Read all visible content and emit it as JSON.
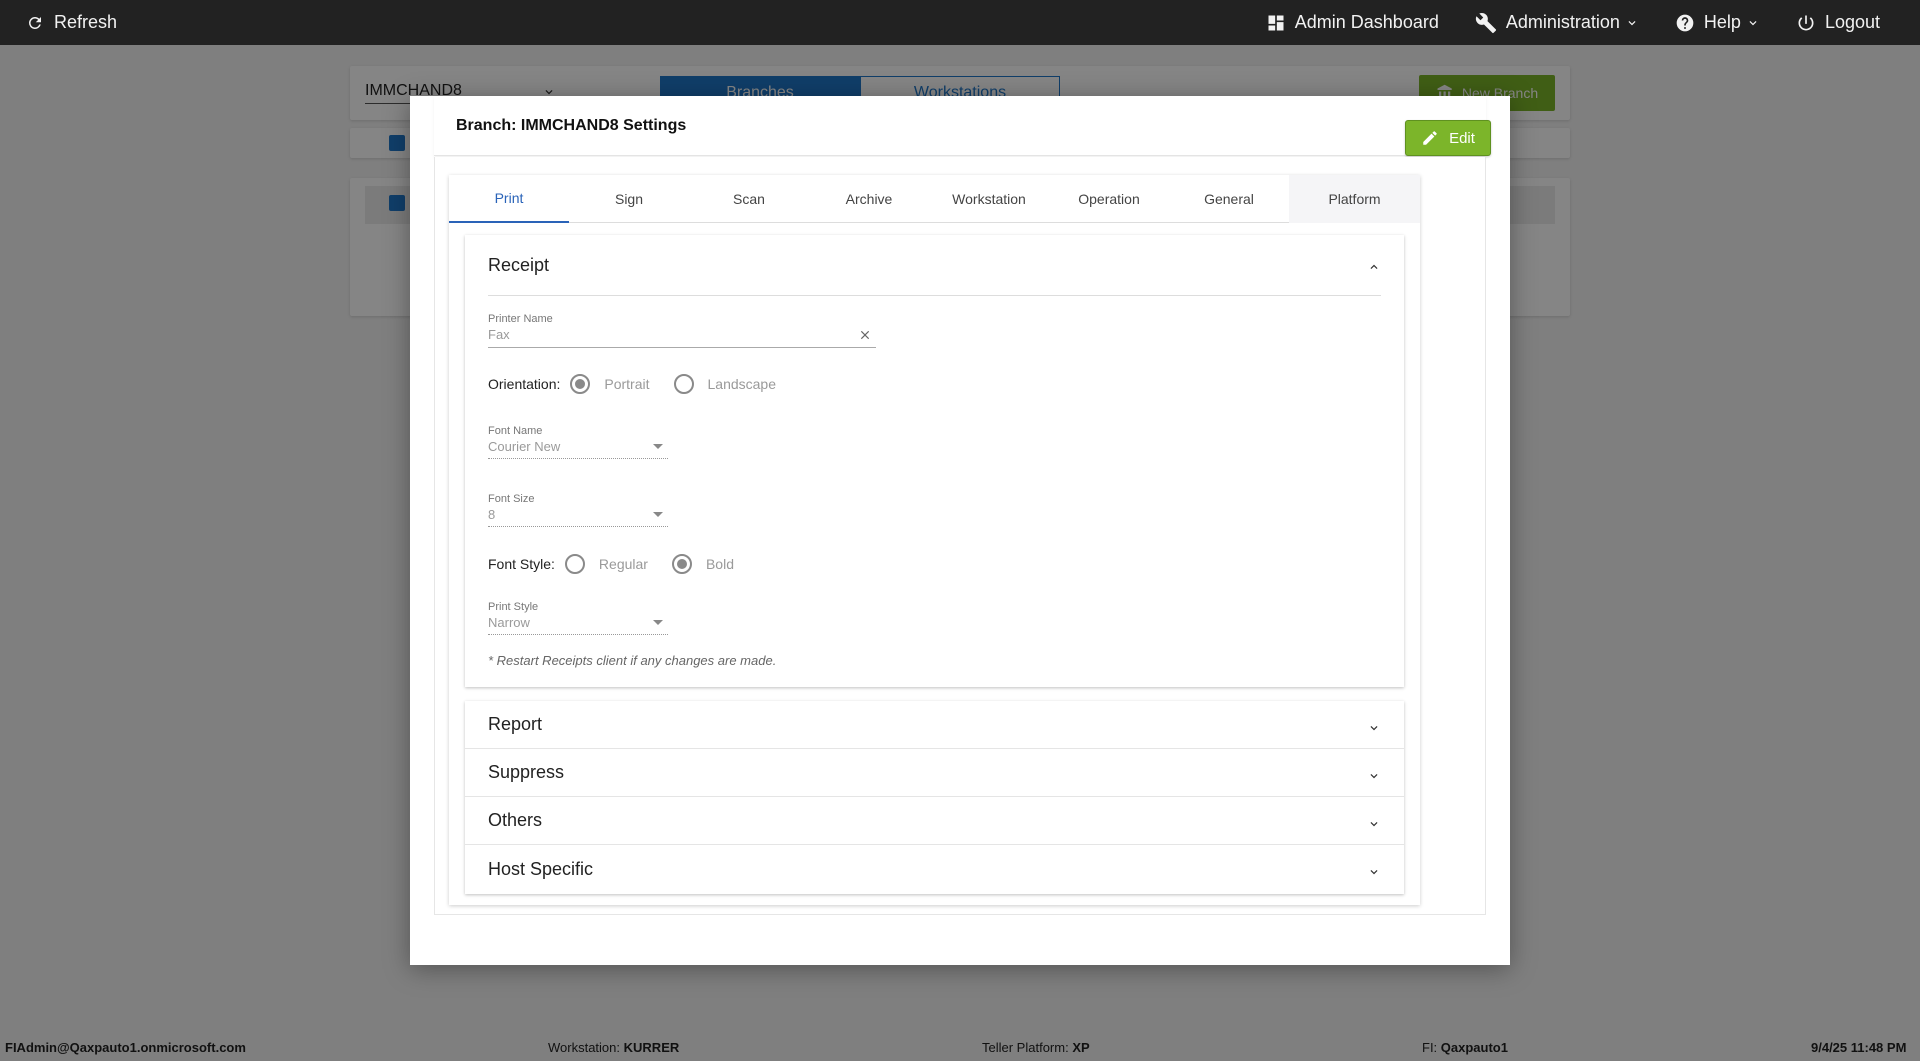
{
  "topbar": {
    "refresh_label": "Refresh",
    "admin_dashboard_label": "Admin Dashboard",
    "administration_label": "Administration",
    "help_label": "Help",
    "logout_label": "Logout"
  },
  "background": {
    "branch_select_value": "IMMCHAND8",
    "tabs": [
      "Branches",
      "Workstations"
    ],
    "new_branch_label": "New Branch"
  },
  "modal": {
    "title": "Branch: IMMCHAND8 Settings",
    "edit_label": "Edit",
    "tabs": [
      "Print",
      "Sign",
      "Scan",
      "Archive",
      "Workstation",
      "Operation",
      "General",
      "Platform"
    ],
    "active_tab": "Print",
    "receipt": {
      "heading": "Receipt",
      "printer_name_label": "Printer Name",
      "printer_name_value": "Fax",
      "orientation_label": "Orientation:",
      "orientation_options": [
        "Portrait",
        "Landscape"
      ],
      "orientation_selected": "Portrait",
      "font_name_label": "Font Name",
      "font_name_value": "Courier New",
      "font_size_label": "Font Size",
      "font_size_value": "8",
      "font_style_label": "Font Style:",
      "font_style_options": [
        "Regular",
        "Bold"
      ],
      "font_style_selected": "Bold",
      "print_style_label": "Print Style",
      "print_style_value": "Narrow",
      "note": "* Restart Receipts client if any changes are made."
    },
    "sections": [
      "Report",
      "Suppress",
      "Others",
      "Host Specific"
    ]
  },
  "statusbar": {
    "user": "FIAdmin@Qaxpauto1.onmicrosoft.com",
    "workstation_label": "Workstation:",
    "workstation_value": "KURRER",
    "platform_label": "Teller Platform:",
    "platform_value": "XP",
    "fi_label": "FI:",
    "fi_value": "Qaxpauto1",
    "datetime": "9/4/25 11:48 PM"
  },
  "colors": {
    "topbar_bg": "#222222",
    "accent_blue": "#2a63b8",
    "edit_green": "#7cb52a"
  }
}
